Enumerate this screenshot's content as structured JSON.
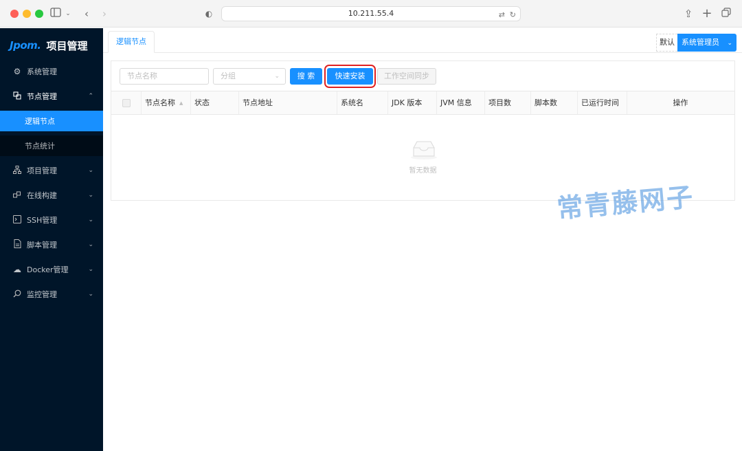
{
  "browser": {
    "url": "10.211.55.4"
  },
  "sidebar": {
    "logo_mark": "Jpom.",
    "logo_title": "项目管理",
    "items": [
      {
        "label": "系统管理",
        "icon": "gear-icon"
      },
      {
        "label": "节点管理",
        "icon": "nodes-icon",
        "open": true
      },
      {
        "label": "项目管理",
        "icon": "tree-icon"
      },
      {
        "label": "在线构建",
        "icon": "build-icon"
      },
      {
        "label": "SSH管理",
        "icon": "terminal-icon"
      },
      {
        "label": "脚本管理",
        "icon": "file-icon"
      },
      {
        "label": "Docker管理",
        "icon": "cloud-icon"
      },
      {
        "label": "监控管理",
        "icon": "monitor-icon"
      }
    ],
    "sub_items": [
      {
        "label": "逻辑节点",
        "active": true
      },
      {
        "label": "节点统计",
        "active": false
      }
    ]
  },
  "main": {
    "tab_label": "逻辑节点",
    "user": {
      "default_label": "默认",
      "role_label": "系统管理员"
    },
    "toolbar": {
      "name_placeholder": "节点名称",
      "group_placeholder": "分组",
      "search_label": "搜 索",
      "quick_install_label": "快速安装",
      "sync_label": "工作空间同步"
    },
    "table": {
      "columns": [
        "节点名称",
        "状态",
        "节点地址",
        "系统名",
        "JDK 版本",
        "JVM 信息",
        "项目数",
        "脚本数",
        "已运行时间",
        "操作"
      ],
      "empty_text": "暂无数据"
    },
    "watermark": "常青藤网子"
  },
  "colors": {
    "sidebar_bg": "#001529",
    "accent": "#1890ff",
    "highlight": "#e02020"
  }
}
